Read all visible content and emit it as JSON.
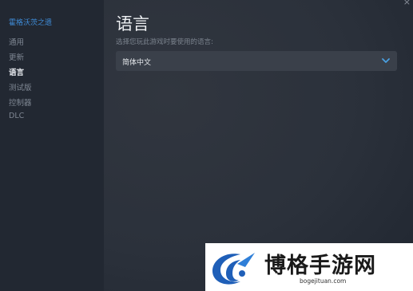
{
  "sidebar": {
    "game_title": "霍格沃茨之遗",
    "items": [
      {
        "label": "通用",
        "active": false
      },
      {
        "label": "更新",
        "active": false
      },
      {
        "label": "语言",
        "active": true
      },
      {
        "label": "测试版",
        "active": false
      },
      {
        "label": "控制器",
        "active": false
      },
      {
        "label": "DLC",
        "active": false
      }
    ]
  },
  "main": {
    "title": "语言",
    "prompt": "选择您玩此游戏时要使用的语言:",
    "language_select": {
      "value": "简体中文"
    }
  },
  "window": {
    "close_glyph": "×"
  },
  "watermark": {
    "text": "博格手游网",
    "url": "bogejituan.com"
  },
  "colors": {
    "accent": "#3f8cd8",
    "sidebar_bg": "#222832",
    "dropdown_bg": "#3a404a",
    "chevron": "#4a9fe0"
  },
  "icons": {
    "dropdown": "chevron-down-icon",
    "close": "close-icon",
    "watermark_logo": "watermark-logo"
  }
}
